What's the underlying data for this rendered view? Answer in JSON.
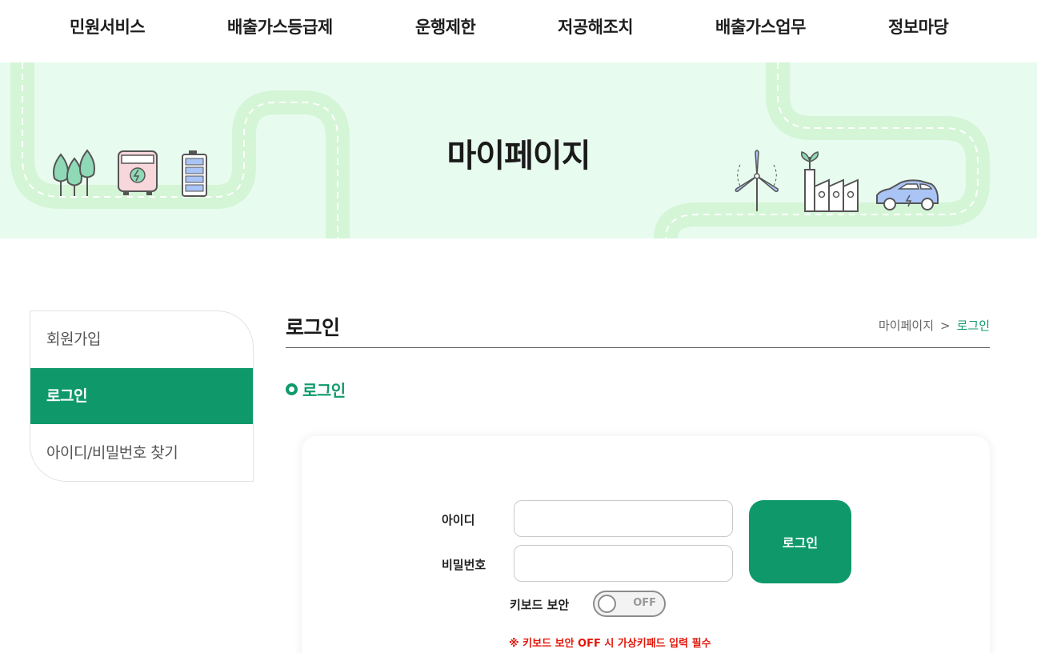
{
  "topnav": {
    "items": [
      "민원서비스",
      "배출가스등급제",
      "운행제한",
      "저공해조치",
      "배출가스업무",
      "정보마당"
    ]
  },
  "banner": {
    "title": "마이페이지"
  },
  "sidebar": {
    "items": [
      {
        "label": "회원가입",
        "active": false
      },
      {
        "label": "로그인",
        "active": true
      },
      {
        "label": "아이디/비밀번호 찾기",
        "active": false
      }
    ]
  },
  "content": {
    "title": "로그인",
    "breadcrumb": {
      "root": "마이페이지",
      "separator": ">",
      "current": "로그인"
    },
    "section_title": "로그인"
  },
  "login": {
    "id_label": "아이디",
    "id_value": "",
    "password_label": "비밀번호",
    "password_value": "",
    "button_label": "로그인",
    "keyboard_security_label": "키보드 보안",
    "keyboard_security_state": "OFF",
    "notice": "※ 키보드 보안 OFF 시 가상키패드 입력 필수"
  },
  "colors": {
    "accent": "#0f996b",
    "banner_bg": "#e8fbef",
    "road": "#d4f5d6",
    "notice": "#e3170a"
  }
}
